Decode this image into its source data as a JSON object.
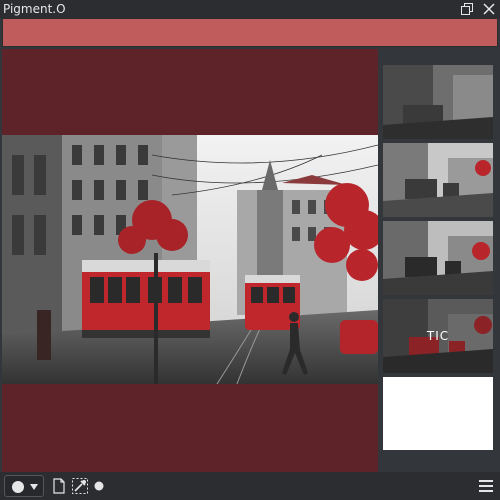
{
  "app": {
    "title": "Pigment.O"
  },
  "window_controls": {
    "restore_icon": "restore-window-icon",
    "close_icon": "close-icon"
  },
  "colors": {
    "foreground": "#c05c5c",
    "background_fill": "#5e2329",
    "accent_red": "#c0272d",
    "panel": "#33363b",
    "titlebar": "#2b2d31"
  },
  "thumbnails": [
    {
      "label": ""
    },
    {
      "label": ""
    },
    {
      "label": ""
    },
    {
      "label": "TIC"
    },
    {
      "label": ""
    }
  ],
  "bottom_toolbar": {
    "mode_icon": "circle-icon",
    "dropdown_icon": "chevron-down-icon",
    "page_icon": "page-icon",
    "eyedropper_icon": "eyedropper-icon",
    "dot_icon": "dot-icon",
    "menu_icon": "hamburger-menu-icon"
  }
}
